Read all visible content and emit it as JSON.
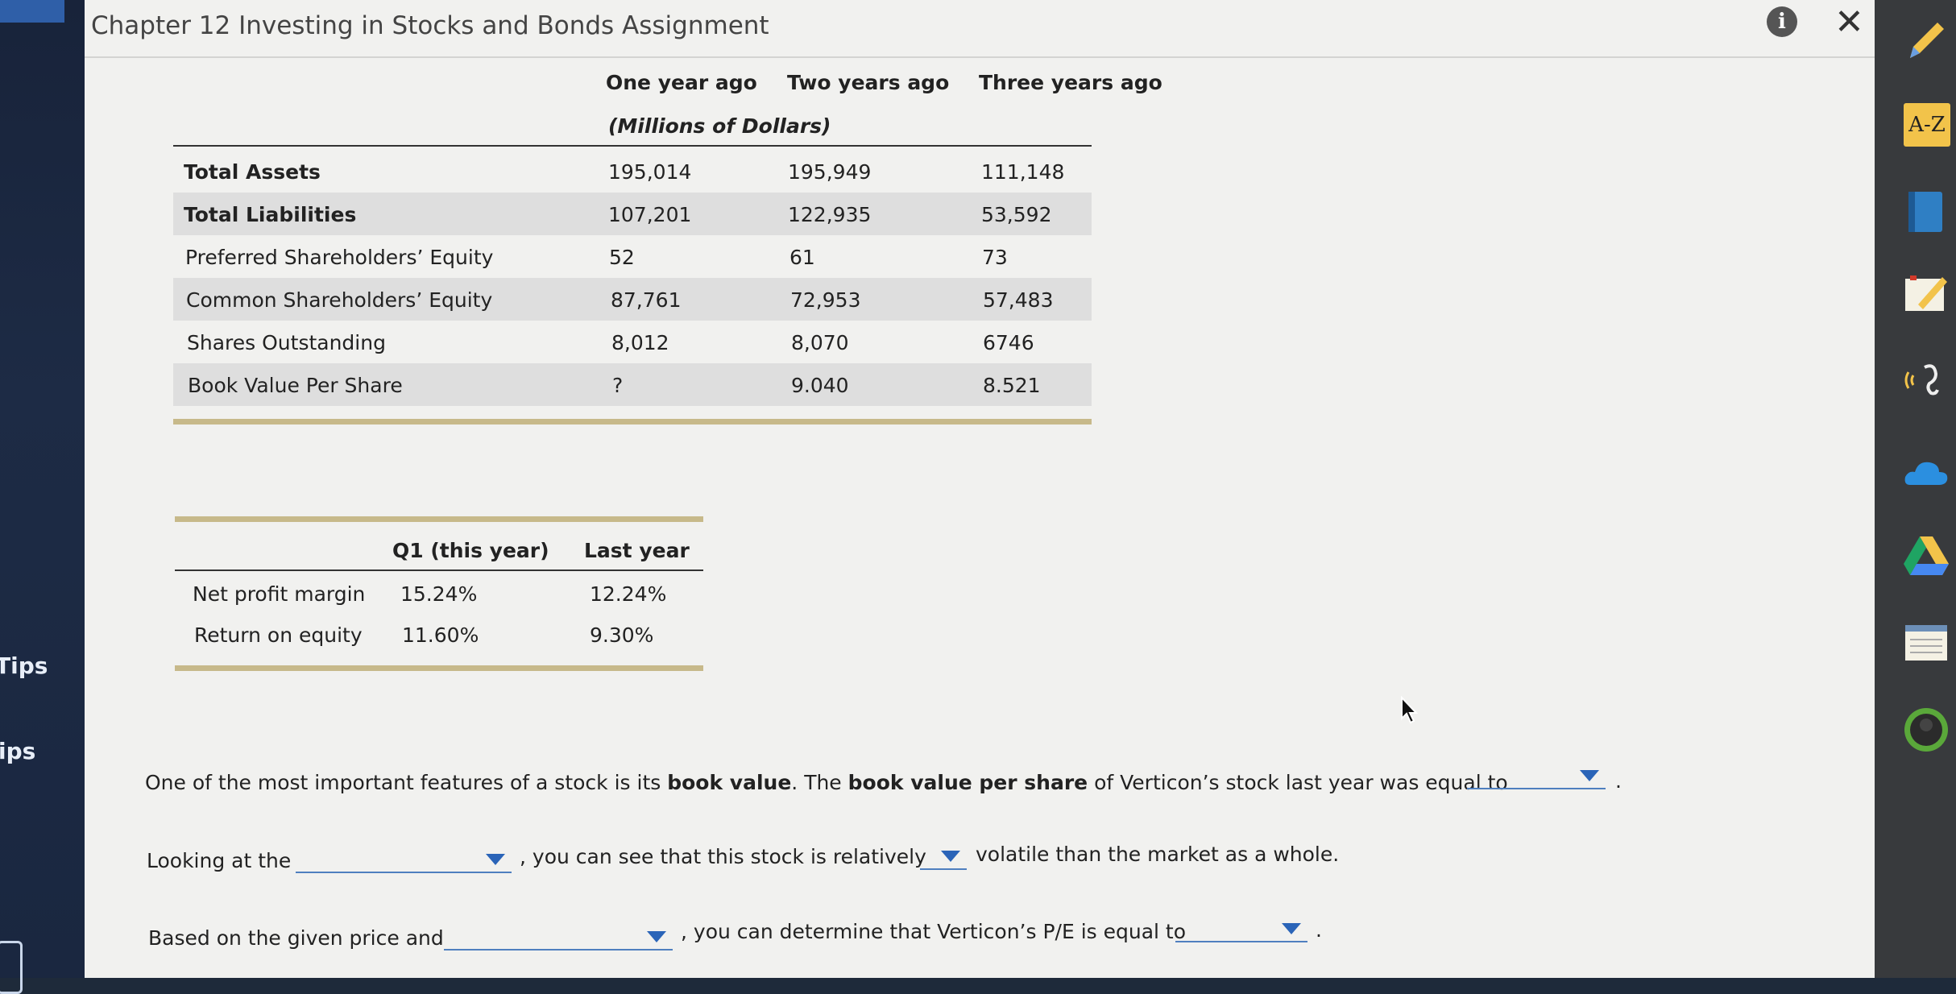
{
  "window": {
    "title": "Chapter 12 Investing in Stocks and Bonds Assignment"
  },
  "left_strip": {
    "tips_1": "Tips",
    "tips_2": "ips"
  },
  "balance_table": {
    "headers": [
      "One year ago",
      "Two years ago",
      "Three years ago"
    ],
    "units": "(Millions of Dollars)",
    "rows": [
      {
        "label": "Total Assets",
        "bold": true,
        "values": [
          "195,014",
          "195,949",
          "111,148"
        ]
      },
      {
        "label": "Total Liabilities",
        "bold": true,
        "values": [
          "107,201",
          "122,935",
          "53,592"
        ]
      },
      {
        "label": "Preferred Shareholders’ Equity",
        "bold": false,
        "values": [
          "52",
          "61",
          "73"
        ]
      },
      {
        "label": "Common Shareholders’ Equity",
        "bold": false,
        "values": [
          "87,761",
          "72,953",
          "57,483"
        ]
      },
      {
        "label": "Shares Outstanding",
        "bold": false,
        "values": [
          "8,012",
          "8,070",
          "6746"
        ]
      },
      {
        "label": "Book Value Per Share",
        "bold": false,
        "values": [
          "?",
          "9.040",
          "8.521"
        ]
      }
    ]
  },
  "ratio_table": {
    "headers": [
      "Q1 (this year)",
      "Last year"
    ],
    "rows": [
      {
        "label": "Net profit margin",
        "values": [
          "15.24%",
          "12.24%"
        ]
      },
      {
        "label": "Return on equity",
        "values": [
          "11.60%",
          "9.30%"
        ]
      }
    ]
  },
  "questions": {
    "q1": {
      "part1": "One of the most important features of a stock is its ",
      "bold1": "book value",
      "part2": ". The ",
      "bold2": "book value per share",
      "part3": " of Verticon’s stock last year was equal to",
      "end": "."
    },
    "q2": {
      "part1": "Looking at the",
      "part2": ", you can see that this stock is relatively",
      "part3": "volatile than the market as a whole."
    },
    "q3": {
      "part1": "Based on the given price and",
      "part2": ", you can determine that Verticon’s P/E is equal to",
      "end": "."
    }
  },
  "toolbar": {
    "az_label": "A-Z",
    "items": [
      "pencil-icon",
      "book-icon",
      "highlighter-icon",
      "text-to-speech-icon",
      "onedrive-icon",
      "google-drive-icon",
      "notes-icon",
      "profile-icon"
    ]
  },
  "colors": {
    "accent_blue": "#2a64b8",
    "table_rule_gold": "#c7b98a",
    "row_shade": "#dedede"
  }
}
